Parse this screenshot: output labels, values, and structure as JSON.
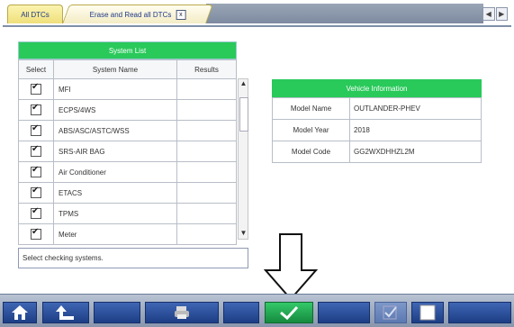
{
  "tabs": {
    "all_dtcs": "All DTCs",
    "erase_read": "Erase and Read all DTCs",
    "close": "x",
    "nav_prev": "◀",
    "nav_next": "▶"
  },
  "system_list": {
    "title": "System List",
    "columns": [
      "Select",
      "System Name",
      "Results"
    ],
    "rows": [
      {
        "checked": true,
        "name": "MFI",
        "result": ""
      },
      {
        "checked": true,
        "name": "ECPS/4WS",
        "result": ""
      },
      {
        "checked": true,
        "name": "ABS/ASC/ASTC/WSS",
        "result": ""
      },
      {
        "checked": true,
        "name": "SRS-AIR BAG",
        "result": ""
      },
      {
        "checked": true,
        "name": "Air Conditioner",
        "result": ""
      },
      {
        "checked": true,
        "name": "ETACS",
        "result": ""
      },
      {
        "checked": true,
        "name": "TPMS",
        "result": ""
      },
      {
        "checked": true,
        "name": "Meter",
        "result": ""
      }
    ]
  },
  "message": "Select checking systems.",
  "vehicle_info": {
    "title": "Vehicle Information",
    "rows": [
      {
        "key": "Model Name",
        "value": "OUTLANDER-PHEV"
      },
      {
        "key": "Model Year",
        "value": "2018"
      },
      {
        "key": "Model Code",
        "value": "GG2WXDHHZL2M"
      }
    ]
  },
  "toolbar": {
    "buttons": [
      "home-icon",
      "back-icon",
      "print-icon",
      "checkmark-icon",
      "check-all-icon",
      "uncheck-all-icon"
    ]
  },
  "colors": {
    "header_green": "#29c95a",
    "toolbar_blue": "#2a4f9e",
    "tab_yellow": "#efe07a"
  }
}
